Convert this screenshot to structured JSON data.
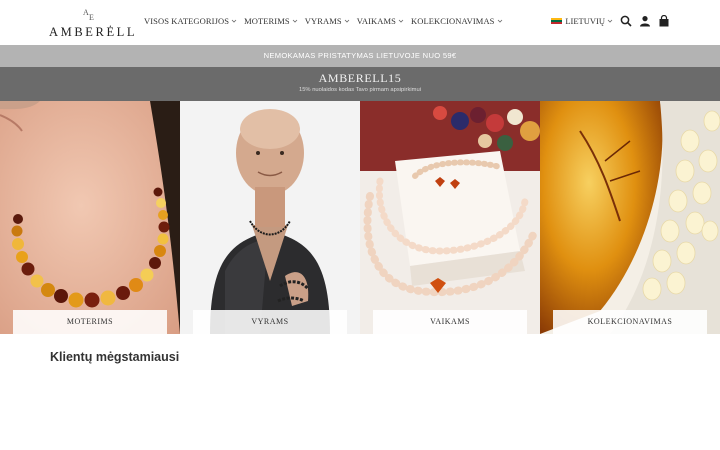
{
  "header": {
    "logo_mono": "A​E",
    "logo_text": "AMBERĖLL",
    "nav": [
      {
        "label": "VISOS KATEGORIJOS"
      },
      {
        "label": "MOTERIMS"
      },
      {
        "label": "VYRAMS"
      },
      {
        "label": "VAIKAMS"
      },
      {
        "label": "KOLEKCIONAVIMAS"
      }
    ],
    "language": "LIETUVIŲ",
    "icons": [
      "search-icon",
      "user-icon",
      "shopping-bag-icon"
    ]
  },
  "shipping_bar": {
    "text": "NEMOKAMAS PRISTATYMAS LIETUVOJE NUO 59€"
  },
  "promo": {
    "code": "AMBERELL15",
    "subtitle": "15% nuolaidos kodas Tavo pirmam apsipirkimui"
  },
  "tiles": [
    {
      "label": "MOTERIMS"
    },
    {
      "label": "VYRAMS"
    },
    {
      "label": "VAIKAMS"
    },
    {
      "label": "KOLEKCIONAVIMAS"
    }
  ],
  "section": {
    "title": "Klientų mėgstamiausi"
  },
  "colors": {
    "shipbar": "#b3b3b3",
    "promobar": "#6b6b6b",
    "flag_yellow": "#fdb913",
    "flag_green": "#006a44",
    "flag_red": "#c1272d"
  }
}
